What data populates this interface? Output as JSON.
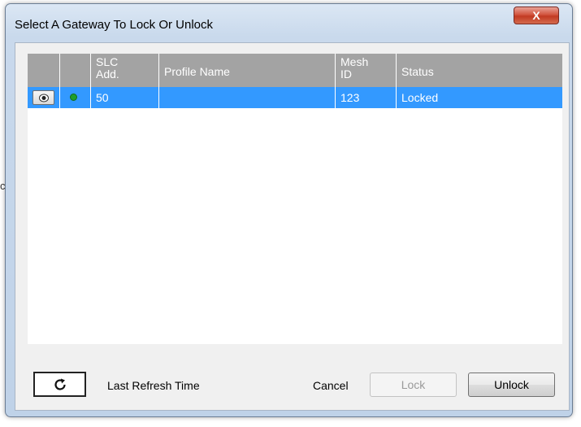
{
  "background": {
    "edge_glyph": "c"
  },
  "dialog": {
    "title": "Select A Gateway To Lock Or Unlock",
    "close_label": "X"
  },
  "table": {
    "columns": [
      {
        "key": "view",
        "label": ""
      },
      {
        "key": "indicator",
        "label": ""
      },
      {
        "key": "slc_add",
        "label": "SLC\nAdd."
      },
      {
        "key": "profile_name",
        "label": "Profile Name"
      },
      {
        "key": "mesh_id",
        "label": "Mesh\nID"
      },
      {
        "key": "status",
        "label": "Status"
      }
    ],
    "rows": [
      {
        "view_icon": "eye-icon",
        "indicator_icon": "green-status-dot-icon",
        "slc_add": "50",
        "profile_name": "",
        "mesh_id": "123",
        "status": "Locked",
        "selected": true
      }
    ]
  },
  "footer": {
    "refresh_icon": "refresh-icon",
    "last_refresh_label": "Last Refresh Time",
    "cancel_label": "Cancel",
    "lock_label": "Lock",
    "lock_enabled": false,
    "unlock_label": "Unlock"
  },
  "colors": {
    "selection": "#3399ff",
    "header_bg": "#a3a3a3",
    "status_dot": "#1f9e2d",
    "close_button": "#c23a22"
  }
}
